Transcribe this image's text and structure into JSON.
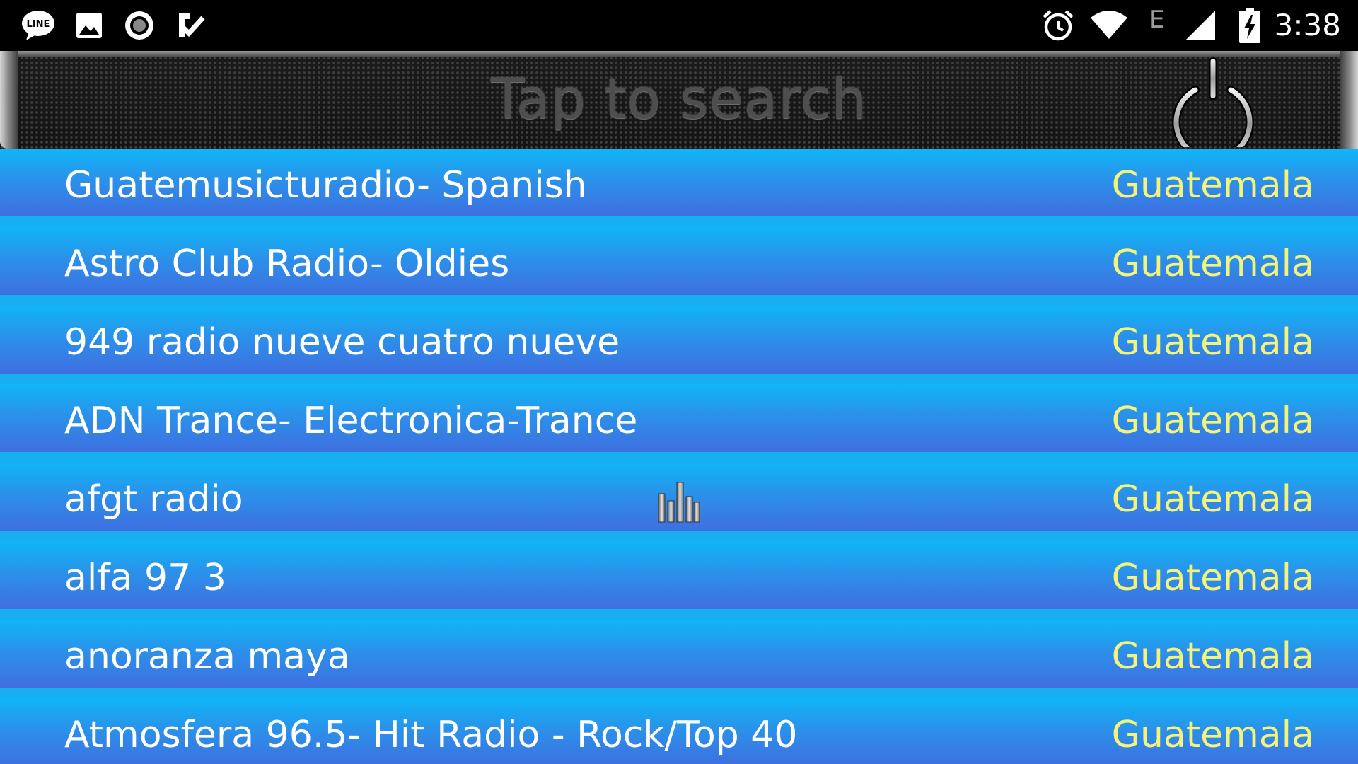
{
  "status_bar": {
    "icons": [
      "line-app-icon",
      "gallery-icon",
      "record-icon",
      "task-check-icon"
    ],
    "system_icons": [
      "alarm-icon",
      "wifi-icon",
      "cell-signal-icon",
      "battery-charging-icon"
    ],
    "network_type": "E",
    "time": "3:38"
  },
  "search": {
    "placeholder": "Tap to search",
    "power_icon": "power-icon"
  },
  "stations": [
    {
      "name": "Guatemusicturadio- Spanish",
      "country": "Guatemala"
    },
    {
      "name": "Astro Club Radio- Oldies",
      "country": "Guatemala"
    },
    {
      "name": "949 radio nueve cuatro nueve",
      "country": "Guatemala"
    },
    {
      "name": "ADN Trance- Electronica-Trance",
      "country": "Guatemala"
    },
    {
      "name": "afgt radio",
      "country": "Guatemala",
      "playing": true
    },
    {
      "name": "alfa 97 3",
      "country": "Guatemala"
    },
    {
      "name": "anoranza maya",
      "country": "Guatemala"
    },
    {
      "name": "Atmosfera 96.5- Hit Radio - Rock/Top 40",
      "country": "Guatemala"
    }
  ],
  "colors": {
    "list_background": "#17aef2",
    "row_top": "#0fb6f7",
    "row_bottom": "#3f6fe0",
    "station_text": "#ffffff",
    "country_text": "#f4f37a"
  }
}
